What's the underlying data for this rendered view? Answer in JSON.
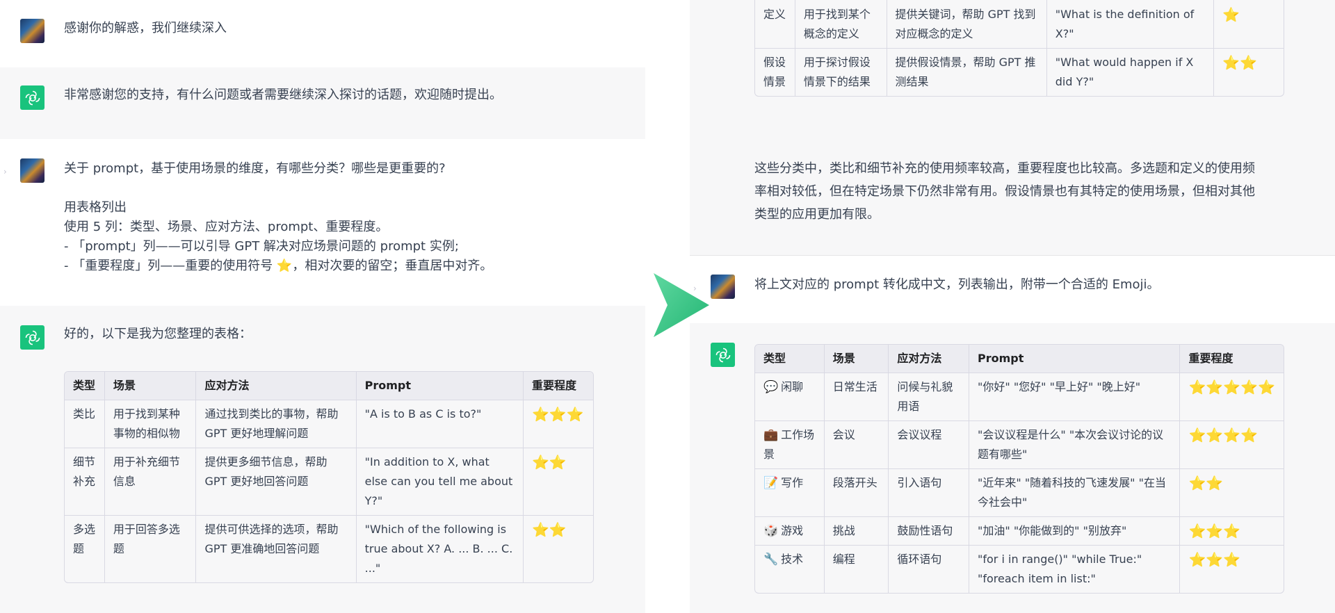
{
  "left_panel": {
    "msg1": {
      "text": "感谢你的解惑，我们继续深入"
    },
    "msg2": {
      "text": "非常感谢您的支持，有什么问题或者需要继续深入探讨的话题，欢迎随时提出。"
    },
    "msg3": {
      "lines": [
        "关于 prompt，基于使用场景的维度，有哪些分类？哪些是更重要的?",
        "",
        "用表格列出",
        "使用 5 列：类型、场景、应对方法、prompt、重要程度。",
        "- 「prompt」列——可以引导 GPT 解决对应场景问题的 prompt 实例;",
        "- 「重要程度」列——重要的使用符号 ⭐，相对次要的留空；垂直居中对齐。"
      ]
    },
    "msg4": {
      "intro": "好的，以下是我为您整理的表格："
    },
    "table": {
      "headers": [
        "类型",
        "场景",
        "应对方法",
        "Prompt",
        "重要程度"
      ],
      "rows": [
        {
          "type": "类比",
          "scene": "用于找到某种事物的相似物",
          "method": "通过找到类比的事物，帮助 GPT 更好地理解问题",
          "prompt": "\"A is to B as C is to?\"",
          "stars": "⭐⭐⭐"
        },
        {
          "type": "细节补充",
          "scene": "用于补充细节信息",
          "method": "提供更多细节信息，帮助 GPT 更好地回答问题",
          "prompt": "\"In addition to X, what else can you tell me about Y?\"",
          "stars": "⭐⭐"
        },
        {
          "type": "多选题",
          "scene": "用于回答多选题",
          "method": "提供可供选择的选项，帮助 GPT 更准确地回答问题",
          "prompt": "\"Which of the following is true about X? A. ... B. ... C. ...\"",
          "stars": "⭐⭐"
        }
      ]
    }
  },
  "right_panel": {
    "top_table": {
      "rows": [
        {
          "type": "定义",
          "scene": "用于找到某个概念的定义",
          "method": "提供关键词，帮助 GPT 找到对应概念的定义",
          "prompt": "\"What is the definition of X?\"",
          "stars": "⭐"
        },
        {
          "type": "假设情景",
          "scene": "用于探讨假设情景下的结果",
          "method": "提供假设情景，帮助 GPT 推测结果",
          "prompt": "\"What would happen if X did Y?\"",
          "stars": "⭐⭐"
        }
      ]
    },
    "summary": {
      "lines": [
        "这些分类中，类比和细节补充的使用频率较高，重要程度也比较高。多选题和定义的使用频",
        "率相对较低，但在特定场景下仍然非常有用。假设情景也有其特定的使用场景，但相对其他",
        "类型的应用更加有限。"
      ]
    },
    "user_msg": {
      "text": "将上文对应的 prompt 转化成中文，列表输出，附带一个合适的 Emoji。"
    },
    "cn_table": {
      "headers": [
        "类型",
        "场景",
        "应对方法",
        "Prompt",
        "重要程度"
      ],
      "rows": [
        {
          "emoji": "💬",
          "type": "闲聊",
          "scene": "日常生活",
          "method": "问候与礼貌用语",
          "prompt": "\"你好\" \"您好\" \"早上好\" \"晚上好\"",
          "stars": "⭐⭐⭐⭐⭐"
        },
        {
          "emoji": "💼",
          "type": "工作场景",
          "scene": "会议",
          "method": "会议议程",
          "prompt": "\"会议议程是什么\" \"本次会议讨论的议题有哪些\"",
          "stars": "⭐⭐⭐⭐"
        },
        {
          "emoji": "📝",
          "type": "写作",
          "scene": "段落开头",
          "method": "引入语句",
          "prompt": "\"近年来\" \"随着科技的飞速发展\" \"在当今社会中\"",
          "stars": "⭐⭐"
        },
        {
          "emoji": "🎲",
          "type": "游戏",
          "scene": "挑战",
          "method": "鼓励性语句",
          "prompt": "\"加油\" \"你能做到的\" \"别放弃\"",
          "stars": "⭐⭐⭐"
        },
        {
          "emoji": "🔧",
          "type": "技术",
          "scene": "编程",
          "method": "循环语句",
          "prompt": "\"for i in range()\" \"while True:\" \"foreach item in list:\"",
          "stars": "⭐⭐⭐"
        }
      ]
    }
  },
  "colors": {
    "bot_background": "#f7f7f8",
    "openai_green": "#19c37d",
    "arrow_green": "#3ec98a",
    "star": "#f5b50a",
    "table_border": "#d9d9e3"
  }
}
